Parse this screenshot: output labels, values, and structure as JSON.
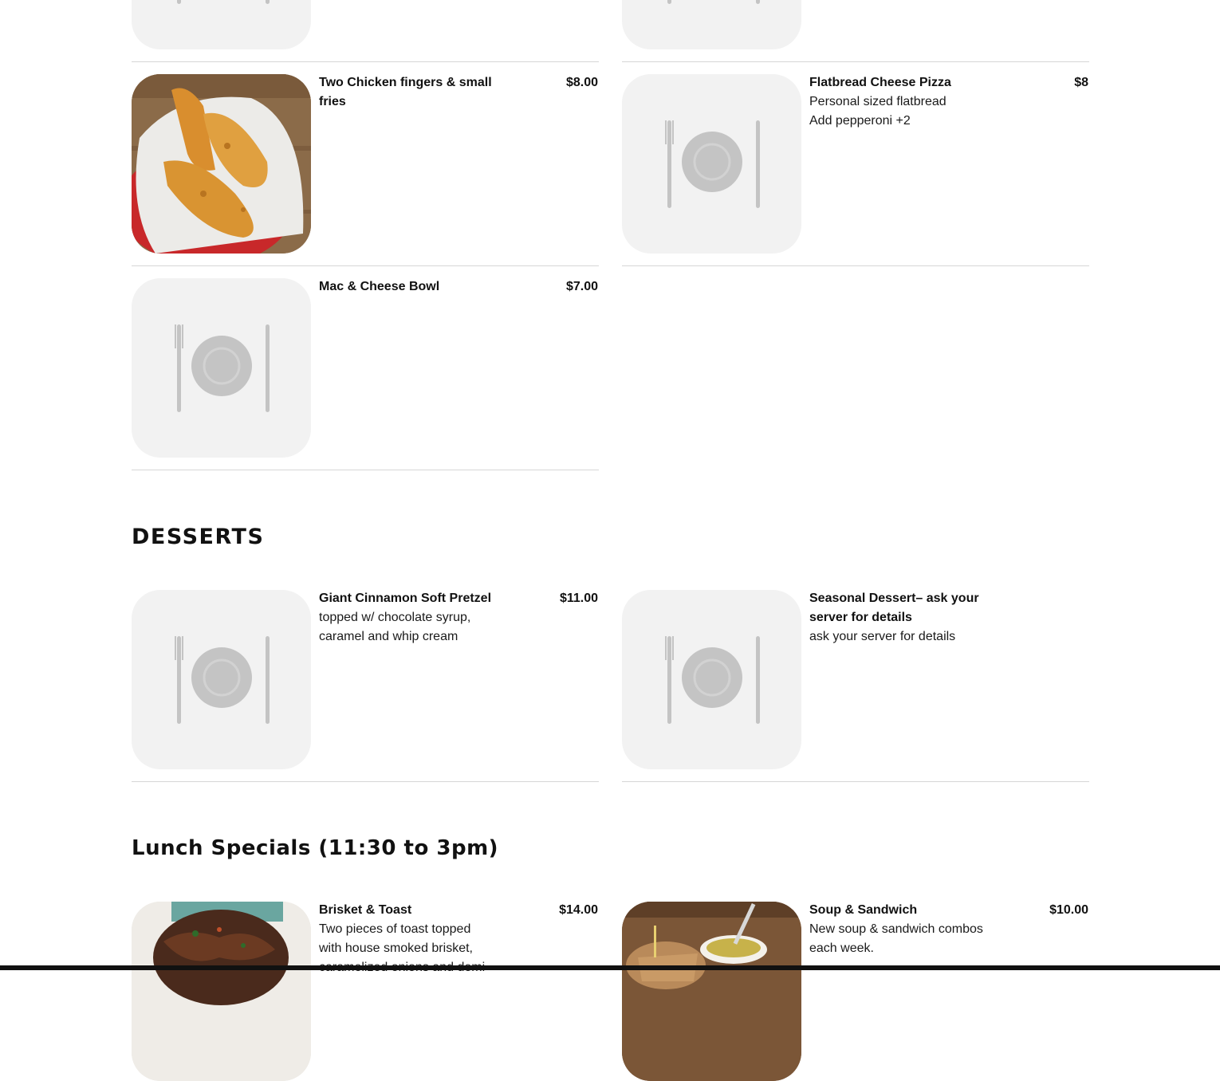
{
  "colors": {
    "accent": "#111111",
    "divider": "#d6d6d6",
    "placeholder_bg": "#f2f2f2",
    "placeholder_icon": "#c4c4c4"
  },
  "kids": {
    "items": [
      {
        "name": "Two Chicken fingers & small fries",
        "price": "$8.00",
        "description": "",
        "image": "chicken-fingers-photo"
      },
      {
        "name": "Flatbread Cheese Pizza",
        "price": "$8",
        "description": "Personal sized flatbread\nAdd pepperoni +2",
        "image": "placeholder-plate-icon"
      },
      {
        "name": "Mac & Cheese Bowl",
        "price": "$7.00",
        "description": "",
        "image": "placeholder-plate-icon"
      }
    ]
  },
  "desserts": {
    "title": "DESSERTS",
    "items": [
      {
        "name": "Giant Cinnamon Soft Pretzel",
        "price": "$11.00",
        "description": "topped w/ chocolate syrup, caramel and whip cream",
        "image": "placeholder-plate-icon"
      },
      {
        "name": "Seasonal Dessert– ask your server for details",
        "price": "",
        "description": "ask your server for details",
        "image": "placeholder-plate-icon"
      }
    ]
  },
  "lunch": {
    "title": "Lunch Specials (11:30 to 3pm)",
    "items": [
      {
        "name": "Brisket & Toast",
        "price": "$14.00",
        "description": "Two pieces of toast topped with house smoked brisket, caramelized onions and demi",
        "image": "brisket-toast-photo"
      },
      {
        "name": "Soup & Sandwich",
        "price": "$10.00",
        "description": "New soup & sandwich combos each week.",
        "image": "soup-sandwich-photo"
      }
    ]
  }
}
